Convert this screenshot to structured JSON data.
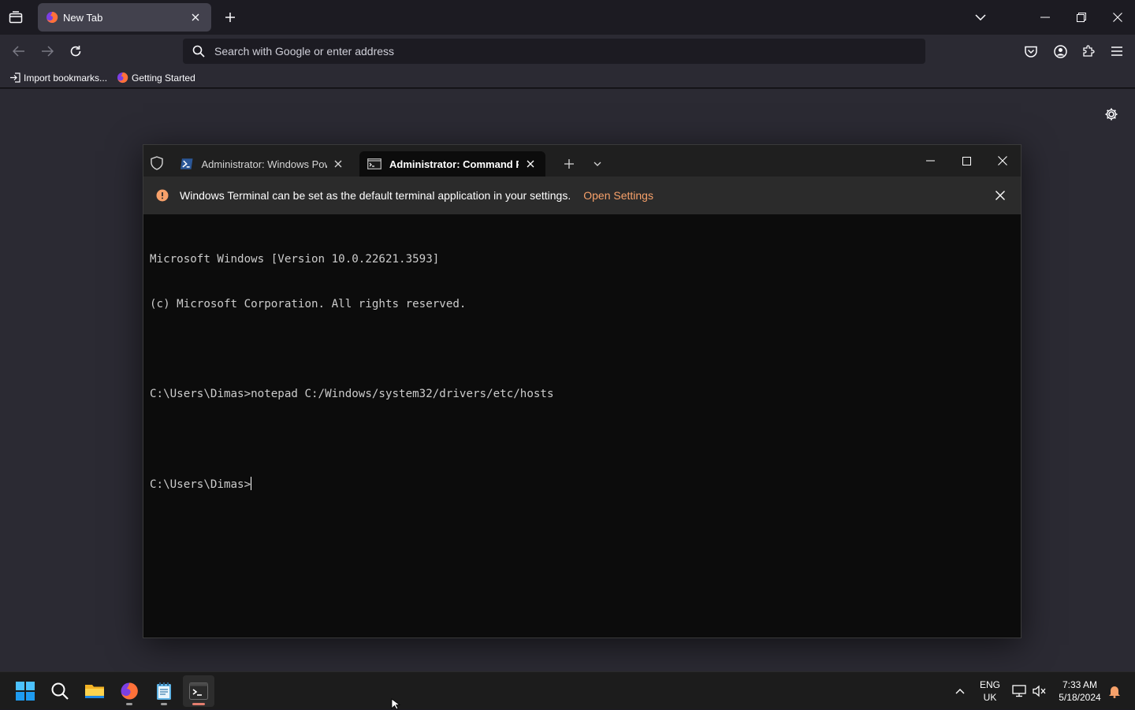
{
  "browser": {
    "tab": {
      "title": "New Tab"
    },
    "urlbar": {
      "placeholder": "Search with Google or enter address"
    },
    "bookmarks": [
      {
        "label": "Import bookmarks..."
      },
      {
        "label": "Getting Started"
      }
    ]
  },
  "terminal": {
    "tabs": [
      {
        "label": "Administrator: Windows PowerShell"
      },
      {
        "label": "Administrator: Command Prompt"
      }
    ],
    "infobar": {
      "message": "Windows Terminal can be set as the default terminal application in your settings.",
      "link": "Open Settings"
    },
    "console": {
      "line1": "Microsoft Windows [Version 10.0.22621.3593]",
      "line2": "(c) Microsoft Corporation. All rights reserved.",
      "line3": "C:\\Users\\Dimas>notepad C:/Windows/system32/drivers/etc/hosts",
      "prompt": "C:\\Users\\Dimas>"
    }
  },
  "taskbar": {
    "lang_top": "ENG",
    "lang_bottom": "UK",
    "time": "7:33 AM",
    "date": "5/18/2024"
  },
  "colors": {
    "accent_orange": "#f7a16a",
    "terminal_bg": "#0c0c0c",
    "firefox_content_bg": "#2b2a33"
  }
}
